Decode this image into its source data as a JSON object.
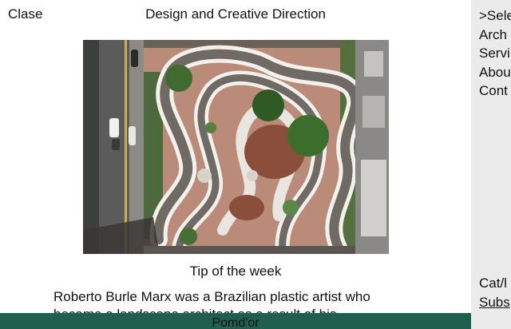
{
  "header": {
    "brand": "Clase",
    "tagline": "Design and Creative Direction"
  },
  "hero": {
    "alt": "Aerial view of a rooftop garden with curving stone paving beside a street"
  },
  "article": {
    "section_title": "Tip of the week",
    "body": "Roberto Burle Marx was a Brazilian plastic artist who became a landscape architect as a result of his"
  },
  "footer": {
    "label": "Pomd'or",
    "color": "#1e5f4e"
  },
  "sidebar": {
    "nav": [
      {
        "label": ">Sele"
      },
      {
        "label": "Arch"
      },
      {
        "label": "Servi"
      },
      {
        "label": "Abou"
      },
      {
        "label": "Cont"
      }
    ],
    "bottom": {
      "category": "Cat/l",
      "subscribe": "Subs"
    },
    "color": "#ebebeb"
  }
}
